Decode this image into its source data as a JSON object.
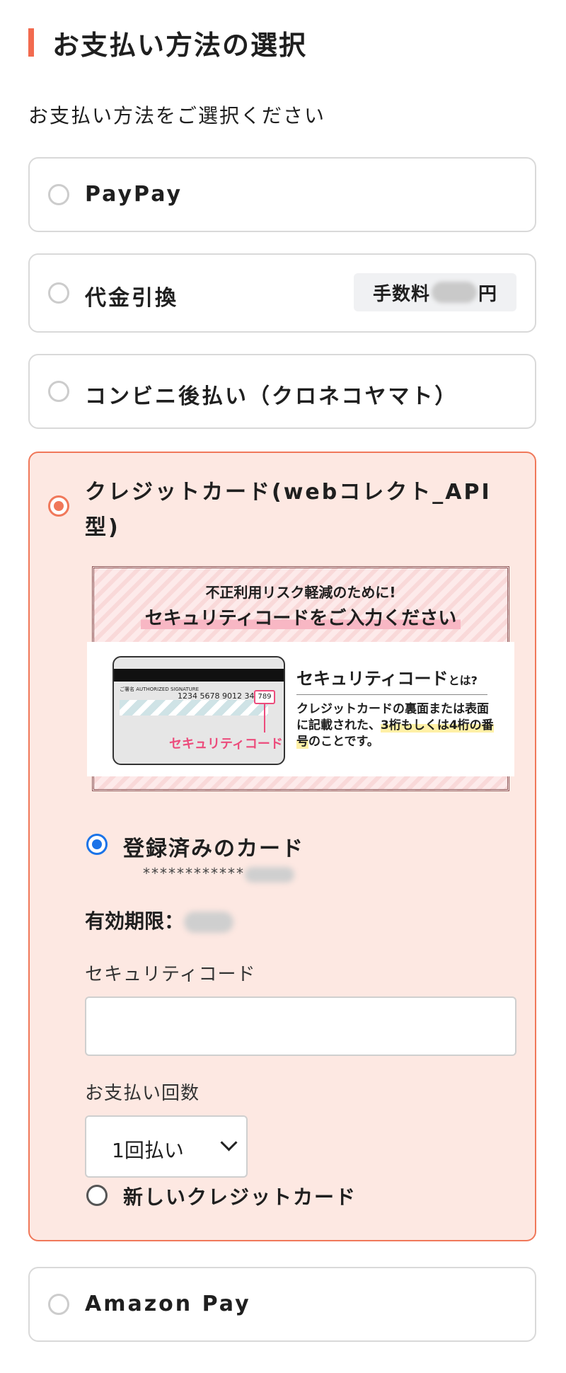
{
  "heading": "お支払い方法の選択",
  "subtitle": "お支払い方法をご選択ください",
  "options": {
    "paypay": "PayPay",
    "cod": "代金引換",
    "cod_fee_prefix": "手数料",
    "cod_fee_suffix": "円",
    "conveni": "コンビニ後払い（クロネコヤマト）",
    "credit_line1": "クレジットカード(webコレクト_API",
    "credit_line2": "型)",
    "amazon": "Amazon Pay"
  },
  "banner": {
    "top1": "不正利用リスク軽減のために!",
    "top2": "セキュリティコードをご入力ください",
    "card_sig": "ご署名 AUTHORIZED SIGNATURE",
    "card_nums": "1234 5678 9012 3456",
    "card_cvv": "789",
    "card_cvv_label": "セキュリティコード",
    "sc_title": "セキュリティコード",
    "sc_title_suffix": "とは?",
    "sc_desc_pre": "クレジットカードの裏面または表面に記載された、",
    "sc_desc_hl": "3桁もしくは4桁の番号",
    "sc_desc_post": "のことです。"
  },
  "credit": {
    "registered_label": "登録済みのカード",
    "masked_number": "************",
    "expiry_label": "有効期限：",
    "security_code_label": "セキュリティコード",
    "installments_label": "お支払い回数",
    "installments_value": "1回払い",
    "new_card_label": "新しいクレジットカード"
  }
}
